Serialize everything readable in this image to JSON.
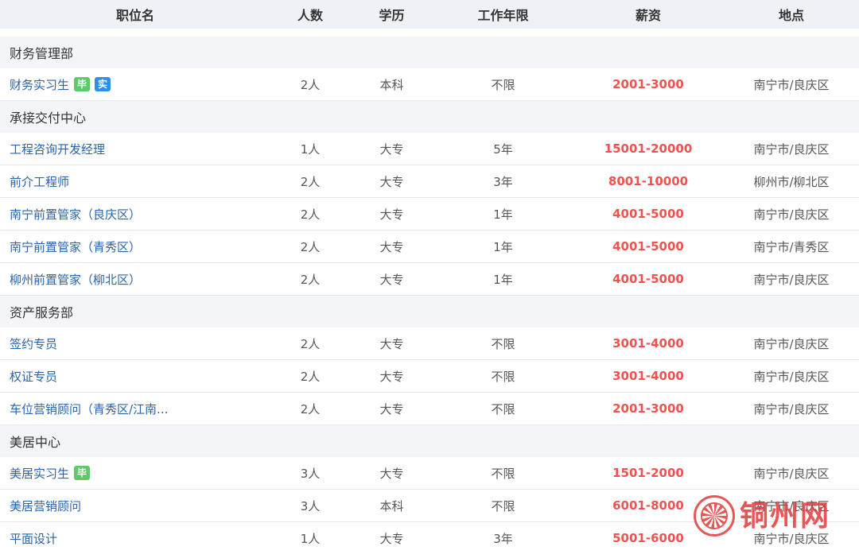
{
  "header": {
    "name": "职位名",
    "count": "人数",
    "education": "学历",
    "experience": "工作年限",
    "salary": "薪资",
    "location": "地点"
  },
  "departments": [
    {
      "name": "财务管理部",
      "jobs": [
        {
          "title": "财务实习生",
          "tags": [
            {
              "text": "毕",
              "kind": "grad"
            },
            {
              "text": "实",
              "kind": "intern"
            }
          ],
          "count": "2人",
          "education": "本科",
          "experience": "不限",
          "salary": "2001-3000",
          "location": "南宁市/良庆区"
        }
      ]
    },
    {
      "name": "承接交付中心",
      "jobs": [
        {
          "title": "工程咨询开发经理",
          "count": "1人",
          "education": "大专",
          "experience": "5年",
          "salary": "15001-20000",
          "location": "南宁市/良庆区"
        },
        {
          "title": "前介工程师",
          "count": "2人",
          "education": "大专",
          "experience": "3年",
          "salary": "8001-10000",
          "location": "柳州市/柳北区"
        },
        {
          "title": "南宁前置管家（良庆区）",
          "count": "2人",
          "education": "大专",
          "experience": "1年",
          "salary": "4001-5000",
          "location": "南宁市/良庆区"
        },
        {
          "title": "南宁前置管家（青秀区）",
          "count": "2人",
          "education": "大专",
          "experience": "1年",
          "salary": "4001-5000",
          "location": "南宁市/青秀区"
        },
        {
          "title": "柳州前置管家（柳北区）",
          "count": "2人",
          "education": "大专",
          "experience": "1年",
          "salary": "4001-5000",
          "location": "南宁市/良庆区"
        }
      ]
    },
    {
      "name": "资产服务部",
      "jobs": [
        {
          "title": "签约专员",
          "count": "2人",
          "education": "大专",
          "experience": "不限",
          "salary": "3001-4000",
          "location": "南宁市/良庆区"
        },
        {
          "title": "权证专员",
          "count": "2人",
          "education": "大专",
          "experience": "不限",
          "salary": "3001-4000",
          "location": "南宁市/良庆区"
        },
        {
          "title": "车位营销顾问（青秀区/江南...",
          "count": "2人",
          "education": "大专",
          "experience": "不限",
          "salary": "2001-3000",
          "location": "南宁市/良庆区"
        }
      ]
    },
    {
      "name": "美居中心",
      "jobs": [
        {
          "title": "美居实习生",
          "tags": [
            {
              "text": "毕",
              "kind": "grad"
            }
          ],
          "count": "3人",
          "education": "大专",
          "experience": "不限",
          "salary": "1501-2000",
          "location": "南宁市/良庆区"
        },
        {
          "title": "美居营销顾问",
          "count": "3人",
          "education": "本科",
          "experience": "不限",
          "salary": "6001-8000",
          "location": "南宁市/良庆区"
        },
        {
          "title": "平面设计",
          "count": "1人",
          "education": "大专",
          "experience": "3年",
          "salary": "5001-6000",
          "location": "南宁市/良庆区"
        }
      ]
    }
  ],
  "watermark": {
    "text": "铜州网"
  },
  "colors": {
    "salary": "#ef5350",
    "link": "#2b63a8",
    "grad_tag": "#5cc96b",
    "intern_tag": "#2f8ee8",
    "header_bg": "#eef1f5",
    "dept_bg": "#f3f5f8"
  }
}
